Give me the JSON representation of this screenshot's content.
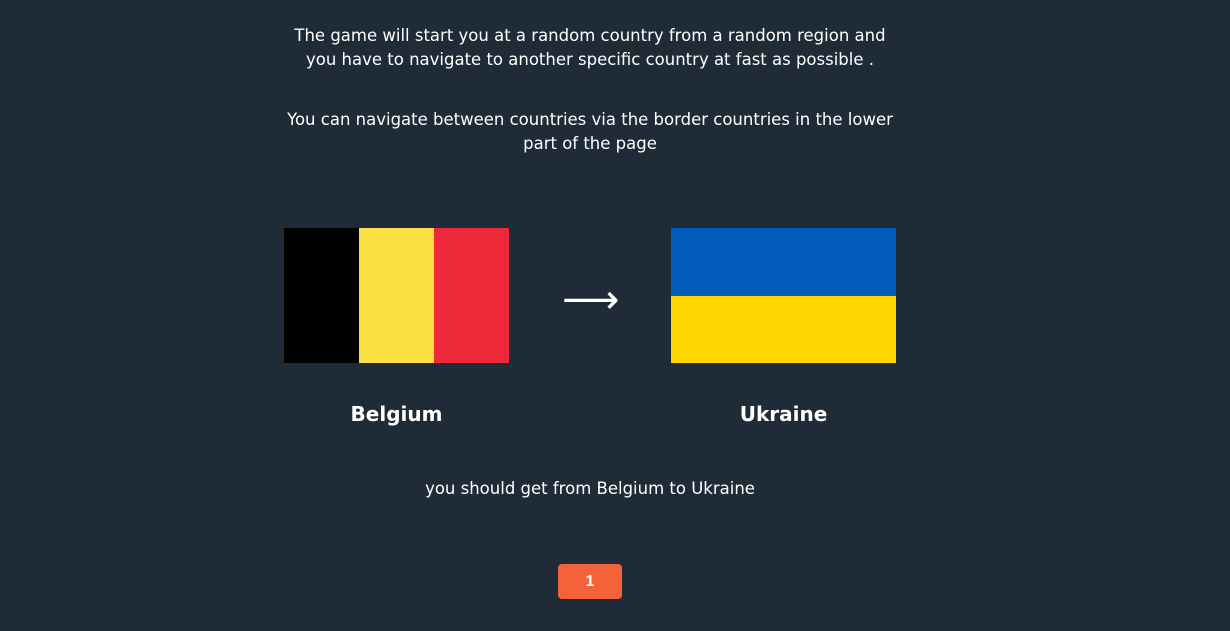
{
  "intro": {
    "line1": "The game will start you at a random country from a random region and you have to navigate to another specific country at fast as possible .",
    "line2": "You can navigate between countries via the border countries in the lower part of the page"
  },
  "start_country": {
    "name": "Belgium",
    "flag": {
      "orientation": "vertical",
      "stripes": [
        "#000000",
        "#FAE042",
        "#ED2939"
      ]
    }
  },
  "arrow": {
    "glyph": "⟶",
    "icon": "right-arrow-icon"
  },
  "target_country": {
    "name": "Ukraine",
    "flag": {
      "orientation": "horizontal",
      "stripes": [
        "#005BBB",
        "#FFD500"
      ]
    }
  },
  "goal_text": "you should get from Belgium to Ukraine",
  "counter_button": {
    "label": "1",
    "color": "#f4623a"
  },
  "colors": {
    "background": "#202b38",
    "text": "#ffffff"
  }
}
